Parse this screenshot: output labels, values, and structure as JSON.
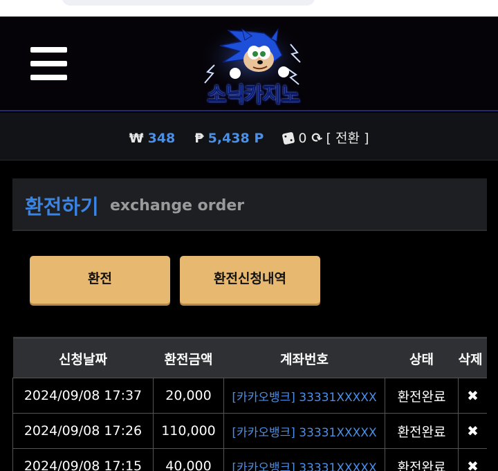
{
  "header": {
    "logo_text": "소닉카지노"
  },
  "balance": {
    "won_symbol": "₩",
    "won_value": "348",
    "point_symbol": "₱",
    "point_value": "5,438 P",
    "dice_value": "0",
    "convert_label": "[ 전환 ]"
  },
  "section": {
    "title_ko": "환전하기",
    "title_en": "exchange order"
  },
  "buttons": {
    "exchange": "환전",
    "history": "환전신청내역"
  },
  "table": {
    "headers": [
      "신청날짜",
      "환전금액",
      "계좌번호",
      "상태",
      "삭제"
    ],
    "rows": [
      {
        "date": "2024/09/08 17:37",
        "amount": "20,000",
        "account": "[카카오뱅크] 33331XXXXX",
        "status": "환전완료",
        "delete": "✖"
      },
      {
        "date": "2024/09/08 17:26",
        "amount": "110,000",
        "account": "[카카오뱅크] 33331XXXXX",
        "status": "환전완료",
        "delete": "✖"
      },
      {
        "date": "2024/09/08 17:15",
        "amount": "40,000",
        "account": "[카카오뱅크] 33331XXXXX",
        "status": "환전완료",
        "delete": "✖"
      }
    ]
  },
  "colors": {
    "accent_blue": "#3a84e3",
    "button_gold": "#e7b86f",
    "background": "#000000"
  }
}
